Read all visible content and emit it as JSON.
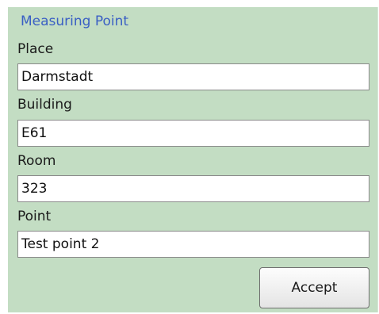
{
  "form": {
    "title": "Measuring Point",
    "fields": [
      {
        "label": "Place",
        "value": "Darmstadt"
      },
      {
        "label": "Building",
        "value": "E61"
      },
      {
        "label": "Room",
        "value": "323"
      },
      {
        "label": "Point",
        "value": "Test point 2"
      }
    ],
    "accept_label": "Accept"
  }
}
